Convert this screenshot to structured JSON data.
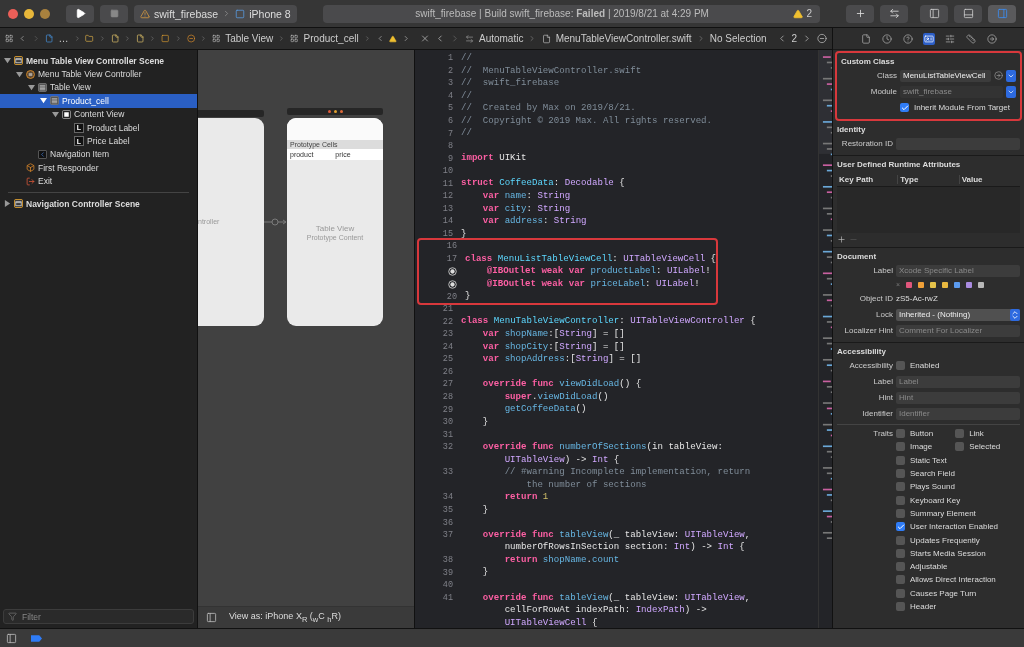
{
  "toolbar": {
    "scheme": {
      "target": "swift_firebase",
      "device": "iPhone 8"
    },
    "status": {
      "text": "swift_firebase | Build swift_firebase: **Failed** | 2019/8/21 at 4:29 PM",
      "warnings": "2"
    },
    "panel_toggles": [
      {
        "kind": "navigator",
        "selected": false
      },
      {
        "kind": "debug",
        "selected": false
      },
      {
        "kind": "inspector",
        "selected": true
      }
    ]
  },
  "navigator_jump_bar": {
    "crumbs": [
      {
        "kind": "project",
        "label": "…"
      },
      {
        "kind": "folder"
      },
      {
        "kind": "file"
      },
      {
        "kind": "file"
      },
      {
        "kind": "scene"
      },
      {
        "kind": "controller"
      },
      {
        "kind": "table",
        "label": "Table View"
      },
      {
        "kind": "table",
        "label": "Product_cell"
      }
    ]
  },
  "navigator": {
    "tree": [
      {
        "label": "Menu Table View Controller Scene",
        "kind": "scene",
        "expanded": true,
        "selected": false,
        "children": [
          {
            "label": "Menu Table View Controller",
            "kind": "controller",
            "expanded": true,
            "selected": false,
            "children": [
              {
                "label": "Table View",
                "kind": "table",
                "expanded": true,
                "selected": false,
                "children": [
                  {
                    "label": "Product_cell",
                    "kind": "table",
                    "expanded": true,
                    "selected": true,
                    "children": [
                      {
                        "label": "Content View",
                        "kind": "view",
                        "expanded": true,
                        "selected": false,
                        "children": [
                          {
                            "label": "Product Label",
                            "kind": "label",
                            "glyph": "L",
                            "selected": false
                          },
                          {
                            "label": "Price Label",
                            "kind": "label",
                            "glyph": "L",
                            "selected": false
                          }
                        ]
                      }
                    ]
                  }
                ]
              },
              {
                "label": "Navigation Item",
                "kind": "navitem",
                "selected": false
              }
            ]
          },
          {
            "label": "First Responder",
            "kind": "responder",
            "selected": false
          },
          {
            "label": "Exit",
            "kind": "exit",
            "selected": false
          }
        ]
      },
      {
        "label": "Navigation Controller Scene",
        "kind": "scene",
        "expanded": false,
        "selected": false
      }
    ],
    "filter_placeholder": "Filter"
  },
  "canvas": {
    "left_scene": {
      "caption": "ntroller"
    },
    "right_scene": {
      "section_header": "Prototype Cells",
      "cell_labels": [
        "product",
        "price"
      ],
      "title": "Table View",
      "subtitle": "Prototype Content"
    },
    "view_as": "View as: iPhone X$_{R}$ ($_{w}$C $_{h}$R)"
  },
  "editor_jump_bar": {
    "mode": "Automatic",
    "file": "MenuTableViewController.swift",
    "selection": "No Selection",
    "counter": "2"
  },
  "code": {
    "blocks": [
      {
        "highlighted": false,
        "lines": [
          {
            "number": "1",
            "outlet": false,
            "rows": [
              {
                "tokens": [
                  {
                    "kind": "comment",
                    "text": "//"
                  }
                ]
              }
            ]
          },
          {
            "number": "2",
            "outlet": false,
            "rows": [
              {
                "tokens": [
                  {
                    "kind": "comment",
                    "text": "//  MenuTableViewController.swift"
                  }
                ]
              }
            ]
          },
          {
            "number": "3",
            "outlet": false,
            "rows": [
              {
                "tokens": [
                  {
                    "kind": "comment",
                    "text": "//  swift_firebase"
                  }
                ]
              }
            ]
          },
          {
            "number": "4",
            "outlet": false,
            "rows": [
              {
                "tokens": [
                  {
                    "kind": "comment",
                    "text": "//"
                  }
                ]
              }
            ]
          },
          {
            "number": "5",
            "outlet": false,
            "rows": [
              {
                "tokens": [
                  {
                    "kind": "comment",
                    "text": "//  Created by Max on 2019/8/21."
                  }
                ]
              }
            ]
          },
          {
            "number": "6",
            "outlet": false,
            "rows": [
              {
                "tokens": [
                  {
                    "kind": "comment",
                    "text": "//  Copyright © 2019 Max. All rights reserved."
                  }
                ]
              }
            ]
          },
          {
            "number": "7",
            "outlet": false,
            "rows": [
              {
                "tokens": [
                  {
                    "kind": "comment",
                    "text": "//"
                  }
                ]
              }
            ]
          },
          {
            "number": "8",
            "outlet": false
          },
          {
            "number": "9",
            "outlet": false,
            "rows": [
              {
                "tokens": [
                  {
                    "kind": "keyword",
                    "text": "import"
                  },
                  {
                    "kind": "plain",
                    "text": " UIKit"
                  }
                ]
              }
            ]
          },
          {
            "number": "10",
            "outlet": false
          },
          {
            "number": "11",
            "outlet": false,
            "rows": [
              {
                "tokens": [
                  {
                    "kind": "keyword",
                    "text": "struct"
                  },
                  {
                    "kind": "decl",
                    "text": " CoffeeData"
                  },
                  {
                    "kind": "plain",
                    "text": ": "
                  },
                  {
                    "kind": "type",
                    "text": "Decodable"
                  },
                  {
                    "kind": "plain",
                    "text": " {"
                  }
                ]
              }
            ]
          },
          {
            "number": "12",
            "outlet": false,
            "rows": [
              {
                "tokens": [
                  {
                    "kind": "keyword",
                    "text": "    var"
                  },
                  {
                    "kind": "name",
                    "text": " name"
                  },
                  {
                    "kind": "plain",
                    "text": ": "
                  },
                  {
                    "kind": "type",
                    "text": "String"
                  }
                ]
              }
            ]
          },
          {
            "number": "13",
            "outlet": false,
            "rows": [
              {
                "tokens": [
                  {
                    "kind": "keyword",
                    "text": "    var"
                  },
                  {
                    "kind": "name",
                    "text": " city"
                  },
                  {
                    "kind": "plain",
                    "text": ": "
                  },
                  {
                    "kind": "type",
                    "text": "String"
                  }
                ]
              }
            ]
          },
          {
            "number": "14",
            "outlet": false,
            "rows": [
              {
                "tokens": [
                  {
                    "kind": "keyword",
                    "text": "    var"
                  },
                  {
                    "kind": "name",
                    "text": " address"
                  },
                  {
                    "kind": "plain",
                    "text": ": "
                  },
                  {
                    "kind": "type",
                    "text": "String"
                  }
                ]
              }
            ]
          },
          {
            "number": "15",
            "outlet": false,
            "rows": [
              {
                "tokens": [
                  {
                    "kind": "plain",
                    "text": "}"
                  }
                ]
              }
            ]
          }
        ]
      },
      {
        "highlighted": true,
        "lines": [
          {
            "number": "16",
            "outlet": false
          },
          {
            "number": "17",
            "outlet": false,
            "rows": [
              {
                "tokens": [
                  {
                    "kind": "keyword",
                    "text": "class"
                  },
                  {
                    "kind": "decl",
                    "text": " MenuListTableViewCell"
                  },
                  {
                    "kind": "plain",
                    "text": ": "
                  },
                  {
                    "kind": "type",
                    "text": "UITableViewCell"
                  },
                  {
                    "kind": "plain",
                    "text": " {"
                  }
                ]
              }
            ]
          },
          {
            "outlet": true,
            "rows": [
              {
                "tokens": [
                  {
                    "kind": "keyword",
                    "text": "    @IBOutlet weak var"
                  },
                  {
                    "kind": "name",
                    "text": " productLabel"
                  },
                  {
                    "kind": "plain",
                    "text": ": "
                  },
                  {
                    "kind": "type",
                    "text": "UILabel"
                  },
                  {
                    "kind": "plain",
                    "text": "!"
                  }
                ]
              }
            ]
          },
          {
            "outlet": true,
            "rows": [
              {
                "tokens": [
                  {
                    "kind": "keyword",
                    "text": "    @IBOutlet weak var"
                  },
                  {
                    "kind": "name",
                    "text": " priceLabel"
                  },
                  {
                    "kind": "plain",
                    "text": ": "
                  },
                  {
                    "kind": "type",
                    "text": "UILabel"
                  },
                  {
                    "kind": "plain",
                    "text": "!"
                  }
                ]
              }
            ]
          },
          {
            "number": "20",
            "outlet": false,
            "rows": [
              {
                "tokens": [
                  {
                    "kind": "plain",
                    "text": "}"
                  }
                ]
              }
            ]
          }
        ]
      },
      {
        "highlighted": false,
        "lines": [
          {
            "number": "21",
            "outlet": false
          },
          {
            "number": "22",
            "outlet": false,
            "rows": [
              {
                "tokens": [
                  {
                    "kind": "keyword",
                    "text": "class"
                  },
                  {
                    "kind": "decl",
                    "text": " MenuTableViewController"
                  },
                  {
                    "kind": "plain",
                    "text": ": "
                  },
                  {
                    "kind": "type",
                    "text": "UITableViewController"
                  },
                  {
                    "kind": "plain",
                    "text": " {"
                  }
                ]
              }
            ]
          },
          {
            "number": "23",
            "outlet": false,
            "rows": [
              {
                "tokens": [
                  {
                    "kind": "keyword",
                    "text": "    var"
                  },
                  {
                    "kind": "name",
                    "text": " shopName"
                  },
                  {
                    "kind": "plain",
                    "text": ":["
                  },
                  {
                    "kind": "type",
                    "text": "String"
                  },
                  {
                    "kind": "plain",
                    "text": "] = []"
                  }
                ]
              }
            ]
          },
          {
            "number": "24",
            "outlet": false,
            "rows": [
              {
                "tokens": [
                  {
                    "kind": "keyword",
                    "text": "    var"
                  },
                  {
                    "kind": "name",
                    "text": " shopCity"
                  },
                  {
                    "kind": "plain",
                    "text": ":["
                  },
                  {
                    "kind": "type",
                    "text": "String"
                  },
                  {
                    "kind": "plain",
                    "text": "] = []"
                  }
                ]
              }
            ]
          },
          {
            "number": "25",
            "outlet": false,
            "rows": [
              {
                "tokens": [
                  {
                    "kind": "keyword",
                    "text": "    var"
                  },
                  {
                    "kind": "name",
                    "text": " shopAddress"
                  },
                  {
                    "kind": "plain",
                    "text": ":["
                  },
                  {
                    "kind": "type",
                    "text": "String"
                  },
                  {
                    "kind": "plain",
                    "text": "] = []"
                  }
                ]
              }
            ]
          },
          {
            "number": "26",
            "outlet": false
          },
          {
            "number": "27",
            "outlet": false,
            "rows": [
              {
                "tokens": [
                  {
                    "kind": "keyword",
                    "text": "    override func"
                  },
                  {
                    "kind": "name",
                    "text": " viewDidLoad"
                  },
                  {
                    "kind": "plain",
                    "text": "() {"
                  }
                ]
              }
            ]
          },
          {
            "number": "28",
            "outlet": false,
            "rows": [
              {
                "tokens": [
                  {
                    "kind": "keyword",
                    "text": "        super"
                  },
                  {
                    "kind": "plain",
                    "text": "."
                  },
                  {
                    "kind": "name",
                    "text": "viewDidLoad"
                  },
                  {
                    "kind": "plain",
                    "text": "()"
                  }
                ]
              }
            ]
          },
          {
            "number": "29",
            "outlet": false,
            "rows": [
              {
                "tokens": [
                  {
                    "kind": "name",
                    "text": "        getCoffeeData"
                  },
                  {
                    "kind": "plain",
                    "text": "()"
                  }
                ]
              }
            ]
          },
          {
            "number": "30",
            "outlet": false,
            "rows": [
              {
                "tokens": [
                  {
                    "kind": "plain",
                    "text": "    }"
                  }
                ]
              }
            ]
          },
          {
            "number": "31",
            "outlet": false
          },
          {
            "number": "32",
            "outlet": false,
            "rows": [
              {
                "tokens": [
                  {
                    "kind": "keyword",
                    "text": "    override func"
                  },
                  {
                    "kind": "name",
                    "text": " numberOfSections"
                  },
                  {
                    "kind": "plain",
                    "text": "(in tableView:"
                  }
                ]
              },
              {
                "tokens": [
                  {
                    "kind": "type",
                    "text": "        UITableView"
                  },
                  {
                    "kind": "plain",
                    "text": ") -> "
                  },
                  {
                    "kind": "type",
                    "text": "Int"
                  },
                  {
                    "kind": "plain",
                    "text": " {"
                  }
                ]
              }
            ]
          },
          {
            "number": "33",
            "outlet": false,
            "rows": [
              {
                "tokens": [
                  {
                    "kind": "comment",
                    "text": "        // #warning Incomplete implementation, return"
                  }
                ]
              },
              {
                "tokens": [
                  {
                    "kind": "comment",
                    "text": "            the number of sections"
                  }
                ]
              }
            ]
          },
          {
            "number": "34",
            "outlet": false,
            "rows": [
              {
                "tokens": [
                  {
                    "kind": "keyword",
                    "text": "        return"
                  },
                  {
                    "kind": "number",
                    "text": " 1"
                  }
                ]
              }
            ]
          },
          {
            "number": "35",
            "outlet": false,
            "rows": [
              {
                "tokens": [
                  {
                    "kind": "plain",
                    "text": "    }"
                  }
                ]
              }
            ]
          },
          {
            "number": "36",
            "outlet": false
          },
          {
            "number": "37",
            "outlet": false,
            "rows": [
              {
                "tokens": [
                  {
                    "kind": "keyword",
                    "text": "    override func"
                  },
                  {
                    "kind": "name",
                    "text": " tableView"
                  },
                  {
                    "kind": "plain",
                    "text": "(_ tableView: "
                  },
                  {
                    "kind": "type",
                    "text": "UITableView"
                  },
                  {
                    "kind": "plain",
                    "text": ","
                  }
                ]
              },
              {
                "tokens": [
                  {
                    "kind": "plain",
                    "text": "        numberOfRowsInSection section: "
                  },
                  {
                    "kind": "type",
                    "text": "Int"
                  },
                  {
                    "kind": "plain",
                    "text": ") -> "
                  },
                  {
                    "kind": "type",
                    "text": "Int"
                  },
                  {
                    "kind": "plain",
                    "text": " {"
                  }
                ]
              }
            ]
          },
          {
            "number": "38",
            "outlet": false,
            "rows": [
              {
                "tokens": [
                  {
                    "kind": "keyword",
                    "text": "        return"
                  },
                  {
                    "kind": "name",
                    "text": " shopName"
                  },
                  {
                    "kind": "plain",
                    "text": "."
                  },
                  {
                    "kind": "name",
                    "text": "count"
                  }
                ]
              }
            ]
          },
          {
            "number": "39",
            "outlet": false,
            "rows": [
              {
                "tokens": [
                  {
                    "kind": "plain",
                    "text": "    }"
                  }
                ]
              }
            ]
          },
          {
            "number": "40",
            "outlet": false
          },
          {
            "number": "41",
            "outlet": false,
            "rows": [
              {
                "tokens": [
                  {
                    "kind": "keyword",
                    "text": "    override func"
                  },
                  {
                    "kind": "name",
                    "text": " tableView"
                  },
                  {
                    "kind": "plain",
                    "text": "(_ tableView: "
                  },
                  {
                    "kind": "type",
                    "text": "UITableView"
                  },
                  {
                    "kind": "plain",
                    "text": ","
                  }
                ]
              },
              {
                "tokens": [
                  {
                    "kind": "plain",
                    "text": "        cellForRowAt indexPath: "
                  },
                  {
                    "kind": "type",
                    "text": "IndexPath"
                  },
                  {
                    "kind": "plain",
                    "text": ") ->"
                  }
                ]
              },
              {
                "tokens": [
                  {
                    "kind": "type",
                    "text": "        UITableViewCell"
                  },
                  {
                    "kind": "plain",
                    "text": " {"
                  }
                ]
              }
            ]
          }
        ]
      }
    ]
  },
  "inspector": {
    "tabs": [
      {
        "kind": "file",
        "selected": false
      },
      {
        "kind": "history",
        "selected": false
      },
      {
        "kind": "help",
        "selected": false
      },
      {
        "kind": "identity",
        "selected": true
      },
      {
        "kind": "attributes",
        "selected": false
      },
      {
        "kind": "size",
        "selected": false
      },
      {
        "kind": "connections",
        "selected": false
      }
    ],
    "custom_class": {
      "title": "Custom Class",
      "highlighted": true,
      "class_label": "Class",
      "class_value": "MenuListTableViewCell",
      "module_label": "Module",
      "module_placeholder": "swift_firebase",
      "inherit": {
        "label": "Inherit Module From Target",
        "checked": true
      }
    },
    "identity": {
      "title": "Identity",
      "restoration_label": "Restoration ID"
    },
    "runtime_attributes": {
      "title": "User Defined Runtime Attributes",
      "columns": [
        "Key Path",
        "Type",
        "Value"
      ]
    },
    "document": {
      "title": "Document",
      "label_label": "Label",
      "label_placeholder": "Xcode Specific Label",
      "clear_mark": "×",
      "label_colors": [
        {
          "color": "#e0567c"
        },
        {
          "color": "#f0a038"
        },
        {
          "color": "#e4c24a"
        },
        {
          "color": "#e8b840"
        },
        {
          "color": "#5b9bef"
        },
        {
          "color": "#a98be0"
        },
        {
          "color": "#b8b8b8"
        }
      ],
      "object_id_label": "Object ID",
      "object_id": "zS5-Ac-rwZ",
      "lock_label": "Lock",
      "lock_value": "Inherited - (Nothing)",
      "hint_label": "Localizer Hint",
      "hint_placeholder": "Comment For Localizer"
    },
    "accessibility": {
      "title": "Accessibility",
      "enabled_label": "Accessibility",
      "enabled": {
        "label": "Enabled",
        "checked": false
      },
      "fields": [
        {
          "label": "Label",
          "placeholder": "Label"
        },
        {
          "label": "Hint",
          "placeholder": "Hint"
        },
        {
          "label": "Identifier",
          "placeholder": "Identifier"
        }
      ],
      "traits_label": "Traits",
      "traits": [
        {
          "label": "Button",
          "checked": false
        },
        {
          "label": "Link",
          "checked": false
        },
        {
          "label": "Image",
          "checked": false
        },
        {
          "label": "Selected",
          "checked": false
        },
        {
          "label": "Static Text",
          "checked": false
        },
        {
          "label": "Search Field",
          "checked": false
        },
        {
          "label": "Plays Sound",
          "checked": false
        },
        {
          "label": "Keyboard Key",
          "checked": false
        },
        {
          "label": "Summary Element",
          "checked": false
        },
        {
          "label": "User Interaction Enabled",
          "checked": true
        },
        {
          "label": "Updates Frequently",
          "checked": false
        },
        {
          "label": "Starts Media Session",
          "checked": false
        },
        {
          "label": "Adjustable",
          "checked": false
        },
        {
          "label": "Allows Direct Interaction",
          "checked": false
        },
        {
          "label": "Causes Page Turn",
          "checked": false
        },
        {
          "label": "Header",
          "checked": false
        }
      ]
    }
  }
}
